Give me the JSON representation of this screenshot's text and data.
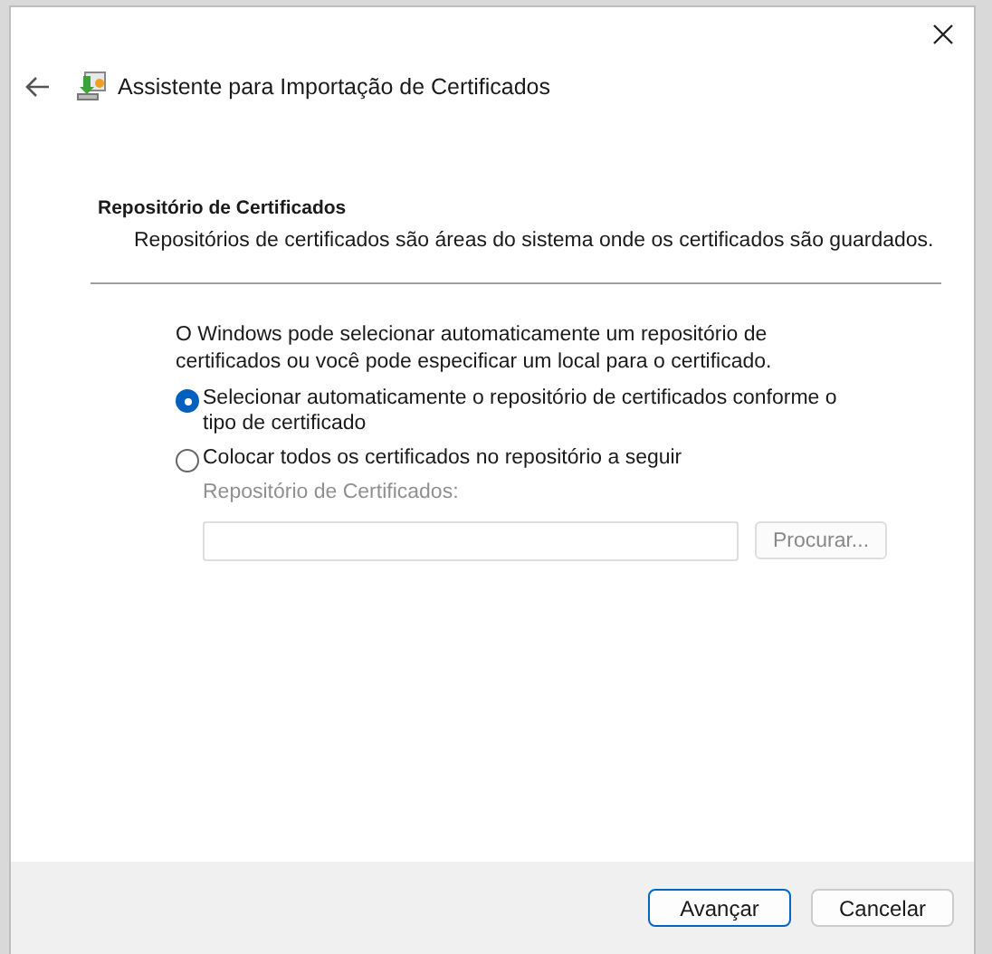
{
  "window": {
    "title": "Assistente para Importação de Certificados"
  },
  "section": {
    "heading": "Repositório de Certificados",
    "description": "Repositórios de certificados são áreas do sistema onde os certificados são guardados."
  },
  "intro": "O Windows pode selecionar automaticamente um repositório de certificados ou você pode especificar um local para o certificado.",
  "options": [
    {
      "label": "Selecionar automaticamente o repositório de certificados conforme o tipo de certificado",
      "selected": true
    },
    {
      "label": "Colocar todos os certificados no repositório a seguir",
      "selected": false
    }
  ],
  "store": {
    "label": "Repositório de Certificados:",
    "disabled": true,
    "browse": "Procurar..."
  },
  "buttons": [
    {
      "label": "Avançar",
      "kind": "primary"
    },
    {
      "label": "Cancelar",
      "kind": "normal"
    }
  ]
}
